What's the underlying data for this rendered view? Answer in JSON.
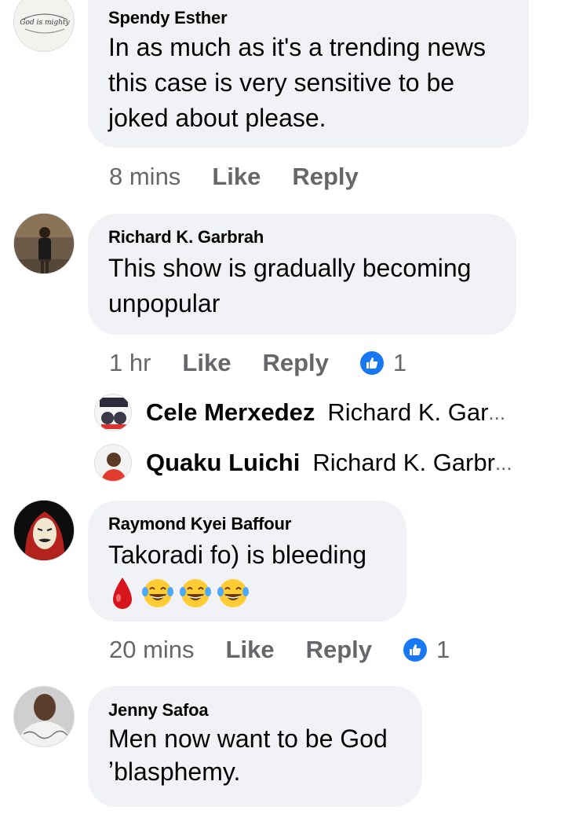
{
  "comments": [
    {
      "author": "Spendy Esther",
      "text": "In as much as it's a trending news\nthis case is very sensitive to be\njoked about please.",
      "time": "8 mins",
      "like_label": "Like",
      "reply_label": "Reply",
      "avatar_text": "God is mighty"
    },
    {
      "author": "Richard K. Garbrah",
      "text": "This show is gradually becoming\nunpopular",
      "time": "1 hr",
      "like_label": "Like",
      "reply_label": "Reply",
      "reactions": "1"
    },
    {
      "author": "Raymond Kyei Baffour",
      "text": "Takoradi fo) is bleeding",
      "time": "20 mins",
      "like_label": "Like",
      "reply_label": "Reply",
      "reactions": "1",
      "emojis": [
        "drop-of-blood-icon",
        "tears-of-joy-icon",
        "tears-of-joy-icon",
        "tears-of-joy-icon"
      ]
    },
    {
      "author": "Jenny Safoa",
      "text": "Men now want to be God\nʼblasphemy."
    }
  ],
  "replies": [
    {
      "author": "Cele Merxedez",
      "preview": "Richard K. Gar",
      "ellipsis": "..."
    },
    {
      "author": "Quaku Luichi",
      "preview": "Richard K. Garbr",
      "ellipsis": "..."
    }
  ],
  "colors": {
    "bubble": "#f0f2f5",
    "meta_text": "#65676b",
    "like_badge": "#1877f2"
  }
}
